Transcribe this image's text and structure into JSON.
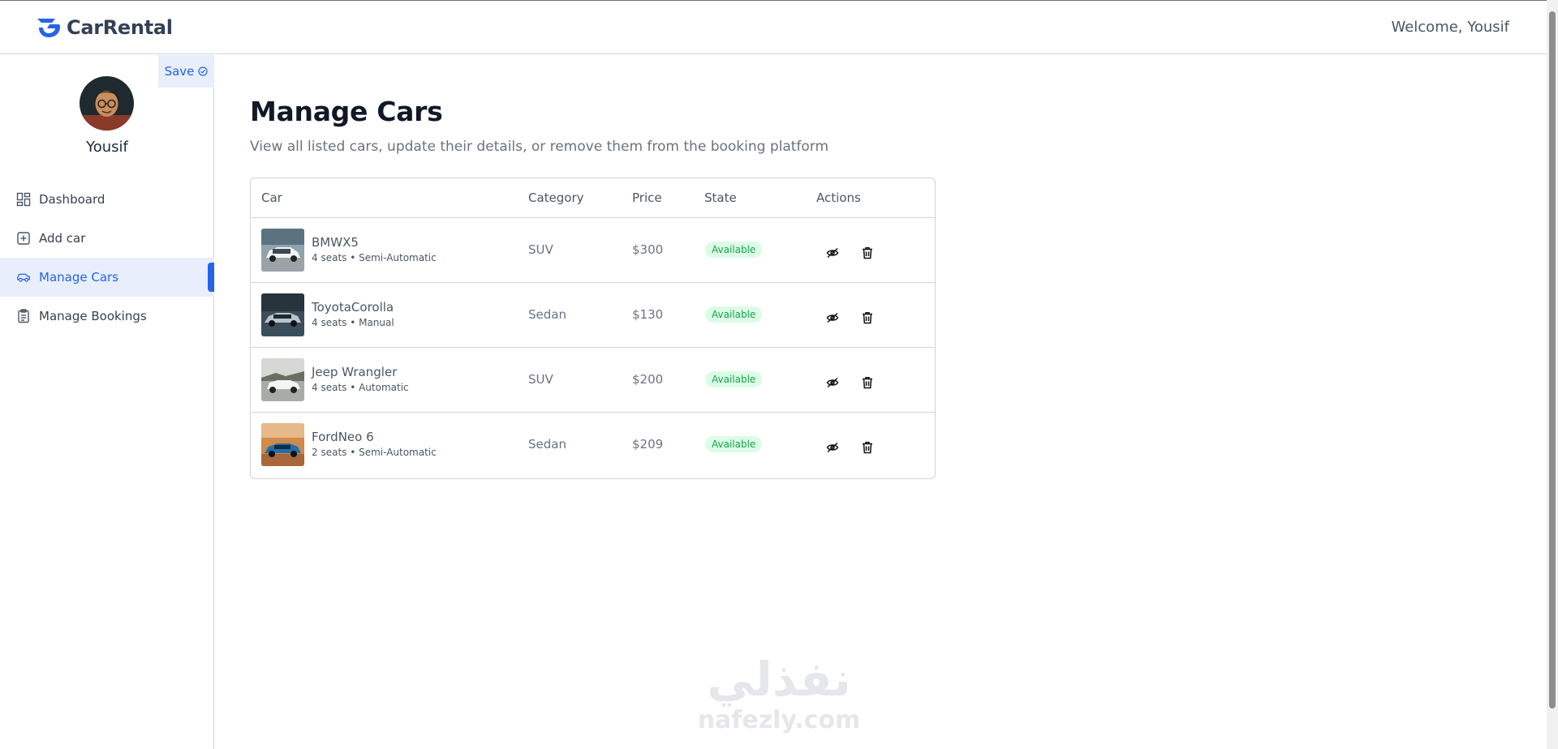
{
  "header": {
    "brand": "CarRental",
    "welcome": "Welcome, Yousif"
  },
  "sidebar": {
    "save_label": "Save",
    "username": "Yousif",
    "items": [
      {
        "label": "Dashboard",
        "icon": "dashboard-icon"
      },
      {
        "label": "Add car",
        "icon": "add-square-icon"
      },
      {
        "label": "Manage Cars",
        "icon": "car-icon",
        "active": true
      },
      {
        "label": "Manage Bookings",
        "icon": "clipboard-icon"
      }
    ]
  },
  "main": {
    "title": "Manage Cars",
    "subtitle": "View all listed cars, update their details, or remove them from the booking platform"
  },
  "table": {
    "headers": {
      "car": "Car",
      "category": "Category",
      "price": "Price",
      "state": "State",
      "actions": "Actions"
    },
    "rows": [
      {
        "name": "BMWX5",
        "meta": "4 seats • Semi-Automatic",
        "category": "SUV",
        "price": "$300",
        "state": "Available"
      },
      {
        "name": "ToyotaCorolla",
        "meta": "4 seats • Manual",
        "category": "Sedan",
        "price": "$130",
        "state": "Available"
      },
      {
        "name": "Jeep Wrangler",
        "meta": "4 seats • Automatic",
        "category": "SUV",
        "price": "$200",
        "state": "Available"
      },
      {
        "name": "FordNeo 6",
        "meta": "2 seats • Semi-Automatic",
        "category": "Sedan",
        "price": "$209",
        "state": "Available"
      }
    ]
  },
  "watermark": {
    "arabic": "نفذلي",
    "latin": "nafezly.com"
  },
  "colors": {
    "accent": "#2563eb",
    "active_bg": "#e8eefc",
    "badge_bg": "#dcfce7",
    "badge_text": "#16a34a"
  }
}
